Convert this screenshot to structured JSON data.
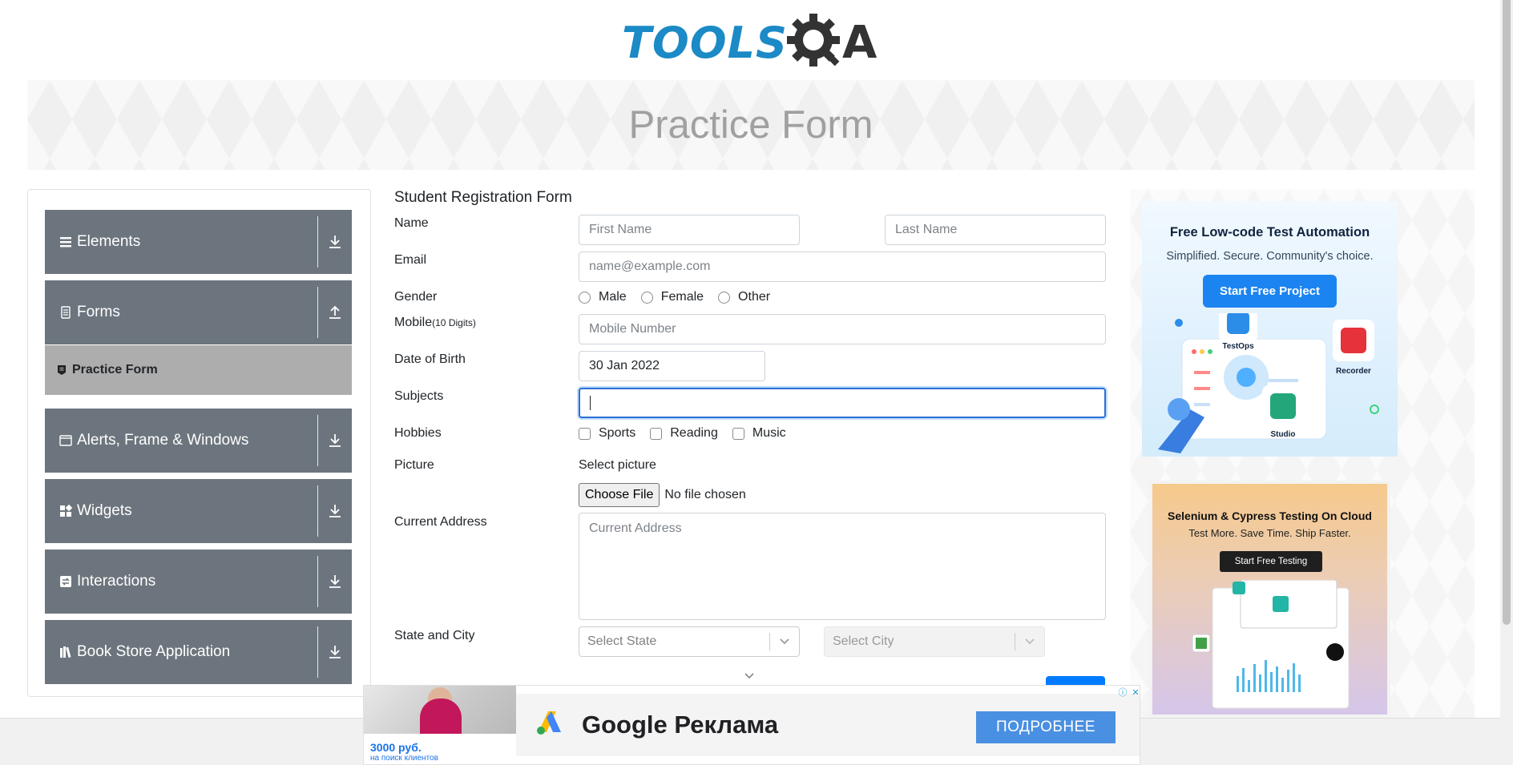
{
  "header": {
    "logo_text": "TOOLS",
    "logo_suffix": "A",
    "page_title": "Practice Form"
  },
  "sidebar": {
    "groups": [
      {
        "label": "Elements",
        "icon": "menu-lines-icon",
        "arrow": "download-arrow-icon"
      },
      {
        "label": "Forms",
        "icon": "document-icon",
        "arrow": "upload-arrow-icon"
      },
      {
        "label": "Alerts, Frame & Windows",
        "icon": "window-icon",
        "arrow": "download-arrow-icon"
      },
      {
        "label": "Widgets",
        "icon": "widgets-grid-icon",
        "arrow": "download-arrow-icon"
      },
      {
        "label": "Interactions",
        "icon": "interactions-icon",
        "arrow": "download-arrow-icon"
      },
      {
        "label": "Book Store Application",
        "icon": "books-icon",
        "arrow": "download-arrow-icon"
      }
    ],
    "active_item": {
      "label": "Practice Form",
      "icon": "form-badge-icon"
    }
  },
  "form": {
    "title": "Student Registration Form",
    "labels": {
      "name": "Name",
      "email": "Email",
      "gender": "Gender",
      "mobile": "Mobile",
      "mobile_hint": "(10 Digits)",
      "dob": "Date of Birth",
      "subjects": "Subjects",
      "hobbies": "Hobbies",
      "picture": "Picture",
      "address": "Current Address",
      "state_city": "State and City"
    },
    "first_name": {
      "placeholder": "First Name",
      "value": ""
    },
    "last_name": {
      "placeholder": "Last Name",
      "value": ""
    },
    "email": {
      "placeholder": "name@example.com",
      "value": ""
    },
    "gender_options": [
      "Male",
      "Female",
      "Other"
    ],
    "mobile": {
      "placeholder": "Mobile Number",
      "value": ""
    },
    "dob_value": "30 Jan 2022",
    "subjects_value": "",
    "hobby_options": [
      "Sports",
      "Reading",
      "Music"
    ],
    "picture_label": "Select picture",
    "file_button": "Choose File",
    "file_status": "No file chosen",
    "address": {
      "placeholder": "Current Address",
      "value": ""
    },
    "state_placeholder": "Select State",
    "city_placeholder": "Select City"
  },
  "ads": {
    "ad1": {
      "title": "Free Low-code Test Automation",
      "subtitle": "Simplified. Secure. Community's choice.",
      "button": "Start Free Project",
      "labels": [
        "TestOps",
        "Recorder",
        "Studio"
      ],
      "accent": "#1c84f0"
    },
    "ad2": {
      "title": "Selenium & Cypress Testing On Cloud",
      "subtitle": "Test More. Save Time. Ship Faster.",
      "button": "Start Free Testing"
    },
    "bottom": {
      "price": "3000 руб.",
      "price_sub": "на поиск клиентов",
      "brand": "Google Реклама",
      "cta": "ПОДРОБНЕЕ",
      "accent": "#4a90e2"
    }
  },
  "colors": {
    "brand_blue": "#1b8ac6",
    "sidebar_group": "#6c757d",
    "sidebar_active": "#adadad",
    "focus_border": "#2d6fd6",
    "submit": "#007bff"
  }
}
